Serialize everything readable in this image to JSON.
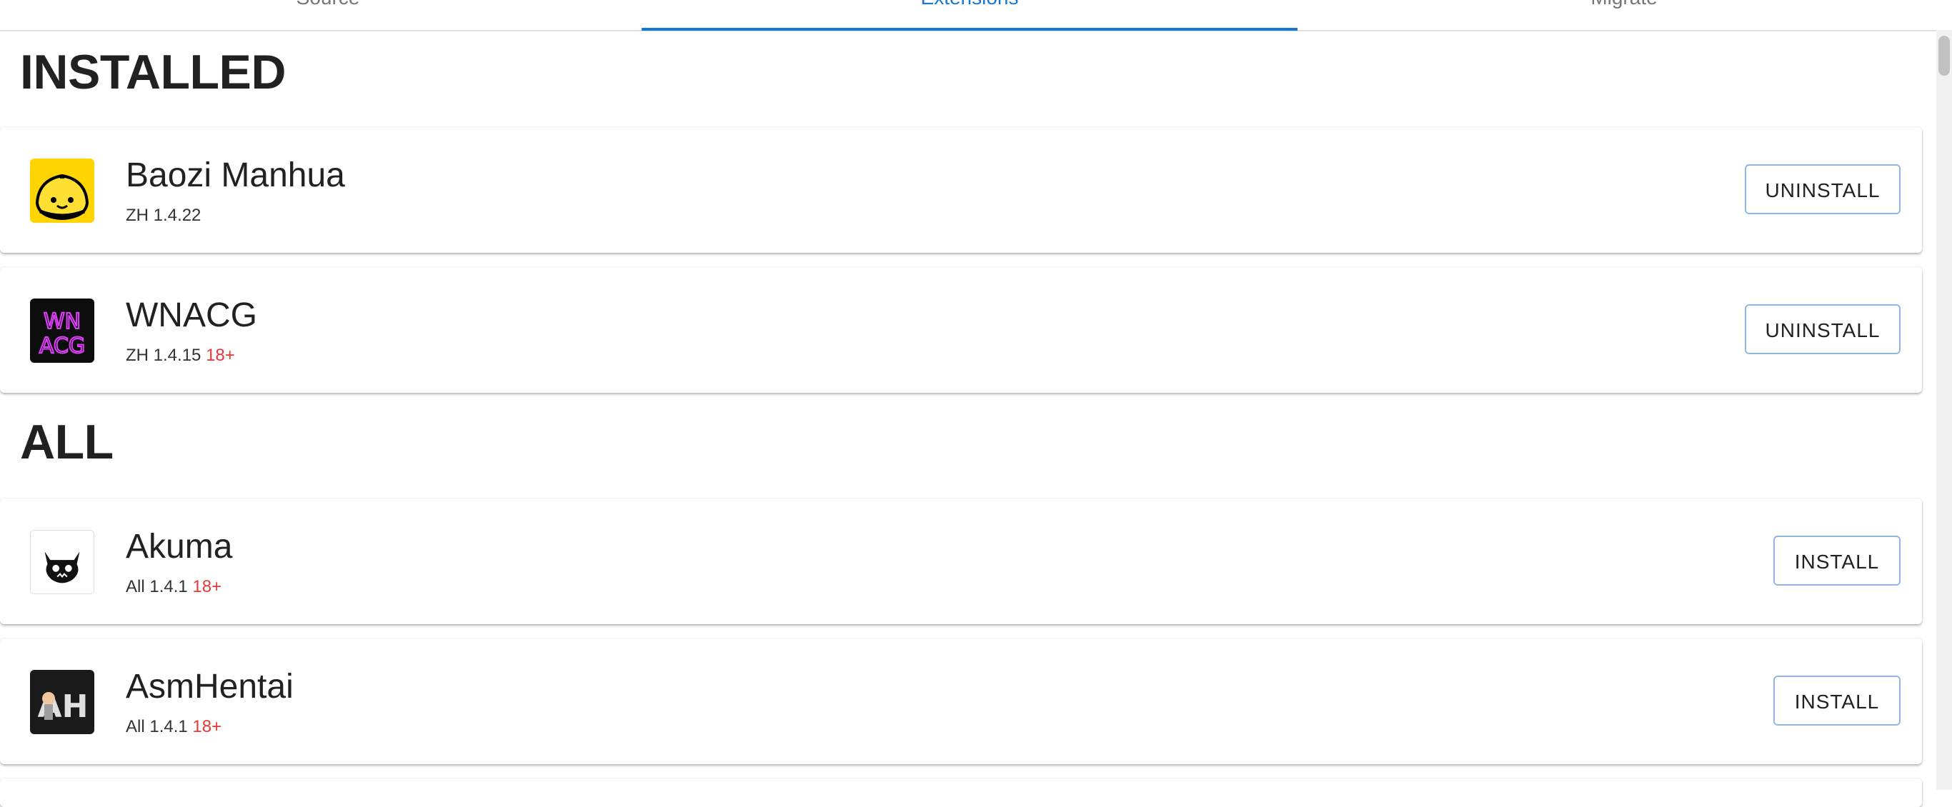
{
  "tabs": [
    {
      "label": "Source"
    },
    {
      "label": "Extensions"
    },
    {
      "label": "Migrate"
    }
  ],
  "sections": {
    "installed_title": "INSTALLED",
    "all_title": "ALL"
  },
  "installed": [
    {
      "name": "Baozi Manhua",
      "meta": "ZH 1.4.22",
      "nsfw": "",
      "action": "UNINSTALL",
      "icon": "baozi-bun-icon"
    },
    {
      "name": "WNACG",
      "meta": "ZH 1.4.15",
      "nsfw": "18+",
      "action": "UNINSTALL",
      "icon": "wnacg-logo-icon"
    }
  ],
  "all": [
    {
      "name": "Akuma",
      "meta": "All 1.4.1",
      "nsfw": "18+",
      "action": "INSTALL",
      "icon": "akuma-demon-icon"
    },
    {
      "name": "AsmHentai",
      "meta": "All 1.4.1",
      "nsfw": "18+",
      "action": "INSTALL",
      "icon": "asmhentai-logo-icon"
    }
  ],
  "colors": {
    "accent": "#1976d2",
    "nsfw": "#e53935",
    "button_border": "#90b8e0"
  }
}
